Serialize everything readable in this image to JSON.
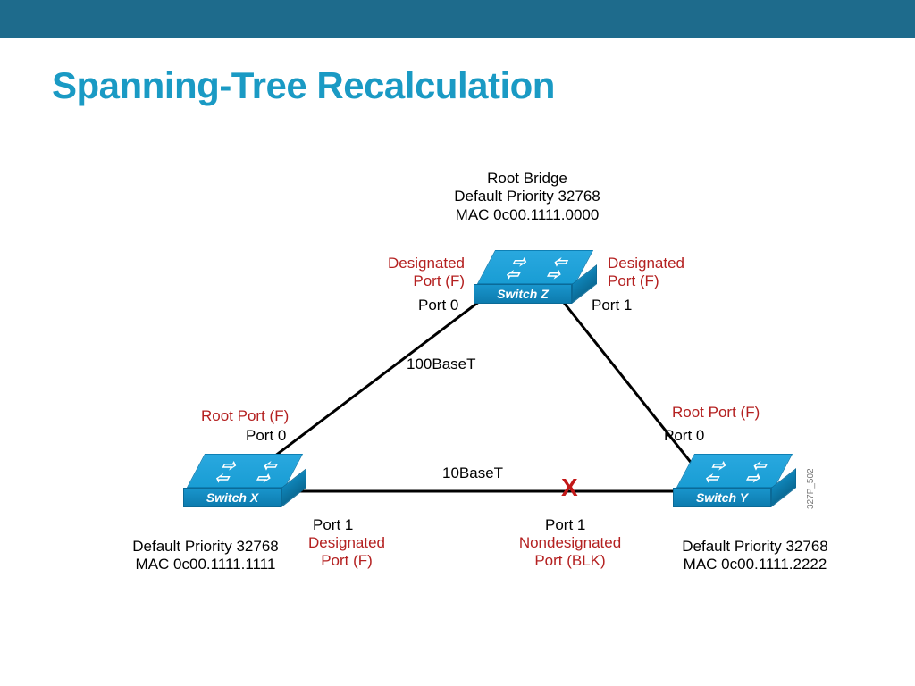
{
  "title": "Spanning-Tree Recalculation",
  "image_ref": "327P_502",
  "switches": {
    "z": {
      "name": "Switch Z",
      "info_line1": "Root Bridge",
      "info_line2": "Default Priority 32768",
      "info_line3": "MAC 0c00.1111.0000",
      "port0_label": "Port 0",
      "port0_role": "Designated",
      "port0_role2": "Port (F)",
      "port1_label": "Port 1",
      "port1_role": "Designated",
      "port1_role2": "Port (F)"
    },
    "x": {
      "name": "Switch X",
      "info_line1": "Default Priority 32768",
      "info_line2": "MAC 0c00.1111.1111",
      "port0_label": "Port 0",
      "port0_role": "Root Port (F)",
      "port1_label": "Port 1",
      "port1_role": "Designated",
      "port1_role2": "Port (F)"
    },
    "y": {
      "name": "Switch Y",
      "info_line1": "Default Priority 32768",
      "info_line2": "MAC 0c00.1111.2222",
      "port0_label": "Port 0",
      "port0_role": "Root Port (F)",
      "port1_label": "Port 1",
      "port1_role": "Nondesignated",
      "port1_role2": "Port (BLK)"
    }
  },
  "links": {
    "zx": "100BaseT",
    "zy": "",
    "xy": "10BaseT"
  }
}
